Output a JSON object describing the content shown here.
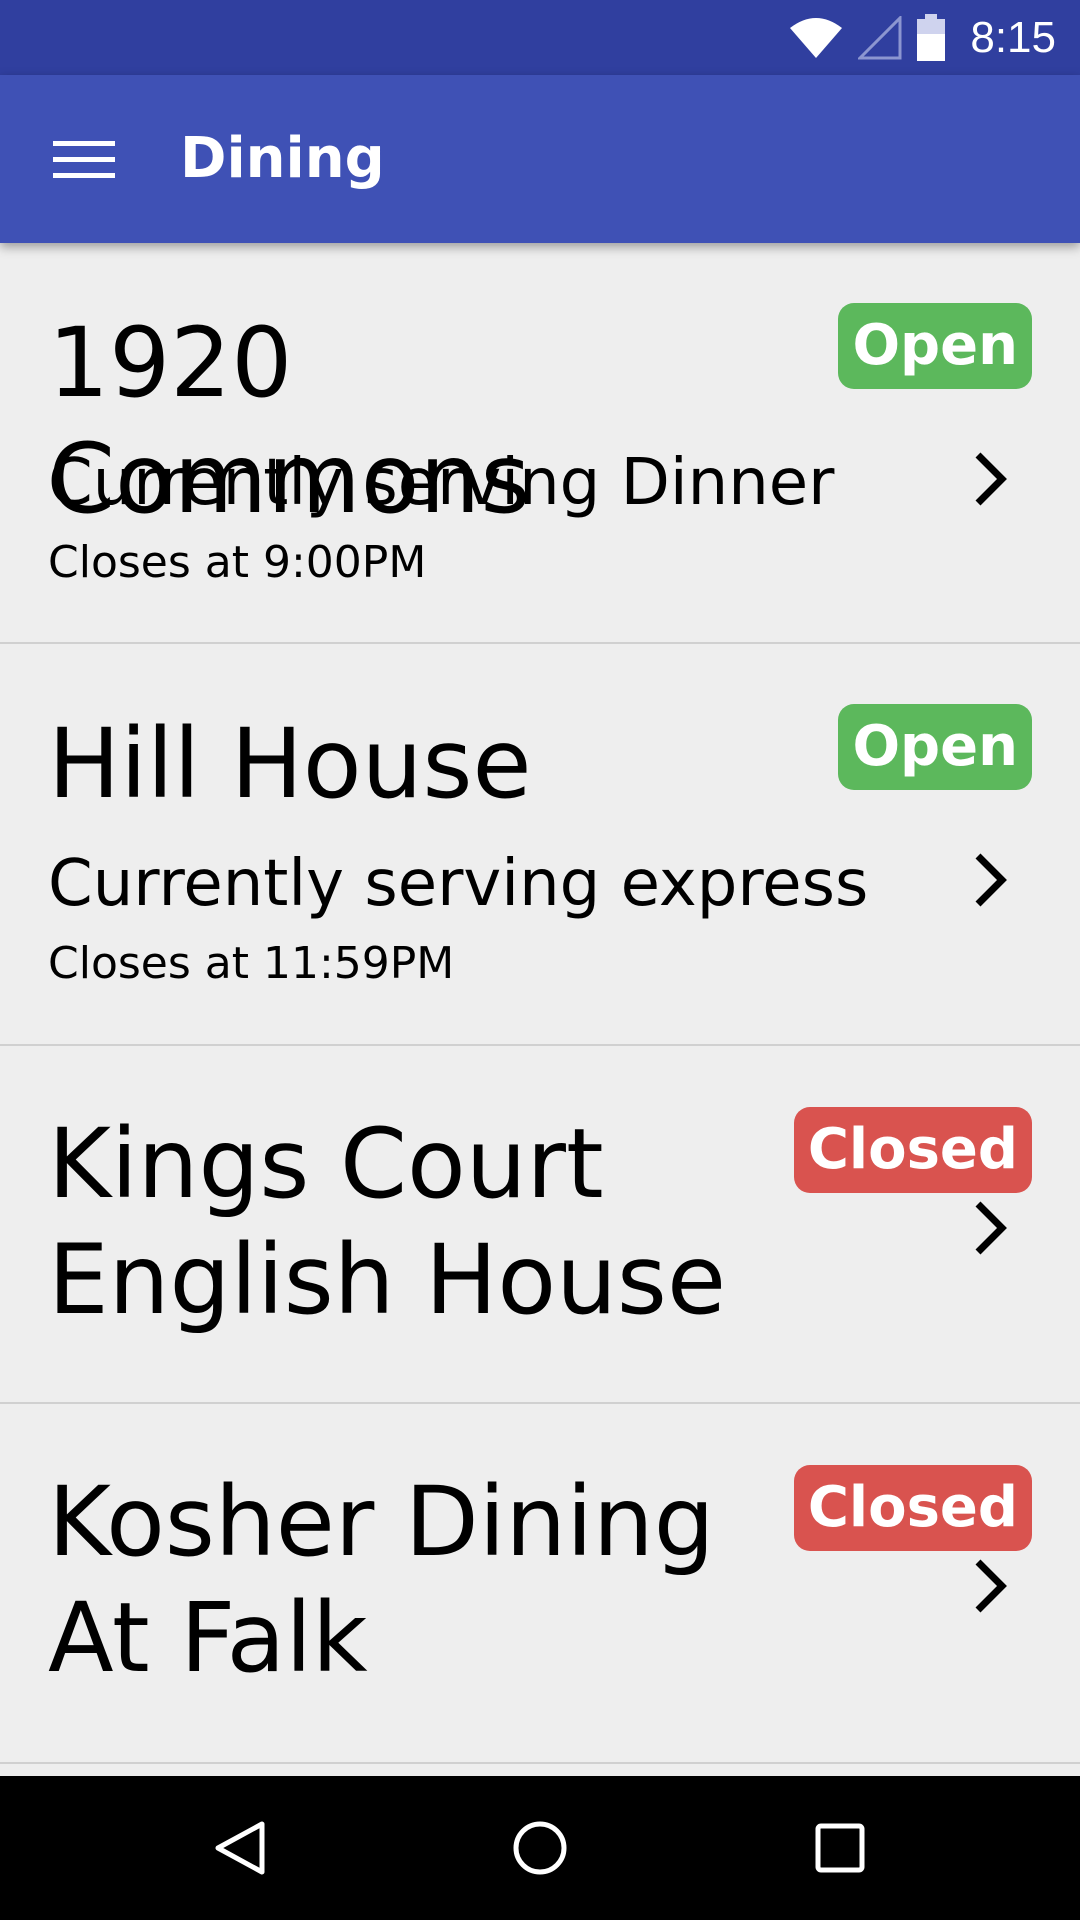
{
  "status_bar": {
    "time": "8:15",
    "icons": [
      "wifi-icon",
      "cell-signal-icon",
      "battery-icon"
    ]
  },
  "app_bar": {
    "title": "Dining",
    "menu_icon": "hamburger-menu-icon"
  },
  "colors": {
    "status_bar": "#303f9f",
    "app_bar": "#3f51b5",
    "open": "#5cb85c",
    "closed": "#d9534f",
    "background": "#eeeeee"
  },
  "halls": [
    {
      "name": "1920 Commons",
      "status": "Open",
      "serving": "Currently serving Dinner",
      "closes": "Closes at 9:00PM"
    },
    {
      "name": "Hill House",
      "status": "Open",
      "serving": "Currently serving express",
      "closes": "Closes at 11:59PM"
    },
    {
      "name": "Kings Court English House",
      "status": "Closed"
    },
    {
      "name": "Kosher Dining At Falk",
      "status": "Closed"
    }
  ],
  "nav_bar": {
    "buttons": [
      "back-icon",
      "home-icon",
      "recents-icon"
    ]
  }
}
